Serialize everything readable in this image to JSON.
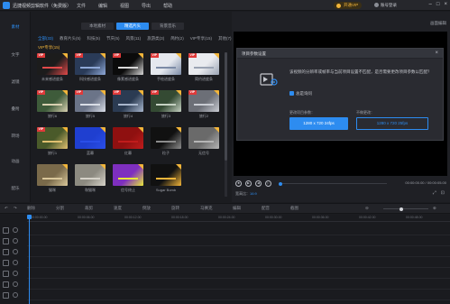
{
  "app": {
    "title": "迅捷视频剪辑软件（免费版）",
    "menu": [
      "文件",
      "编辑",
      "视图",
      "导出",
      "帮助"
    ],
    "vip_label": "开通VIP",
    "user_label": "账号登录",
    "window_buttons": [
      "–",
      "□",
      "×"
    ]
  },
  "left_nav": [
    "素材",
    "文字",
    "滤镜",
    "叠附",
    "转场",
    "动画",
    "配乐"
  ],
  "library": {
    "top_tabs": [
      "本地素材",
      "精选片头",
      "背景音乐"
    ],
    "active_top_tab": 1,
    "sub_tabs": [
      "全部(33)",
      "教育片头(5)",
      "科技(5)",
      "节庆(5)",
      "风景(11)",
      "旅游类(3)",
      "简约(2)",
      "VIP专享(15)",
      "其他(7)"
    ],
    "section_title": "VIP专享(15)",
    "items": [
      {
        "label": "未来感进度条",
        "vip": true,
        "color": "#1c1c1c",
        "accent": "#e24a4a"
      },
      {
        "label": "科技感进度条",
        "vip": true,
        "color": "#2a3b58",
        "accent": "#8fa9d8"
      },
      {
        "label": "像素感进度条",
        "vip": true,
        "color": "#0b0b0b",
        "accent": "#d8d8d8"
      },
      {
        "label": "手绘进度条",
        "vip": true,
        "color": "#e5e8ee",
        "accent": "#7c8ba6"
      },
      {
        "label": "简约进度条",
        "vip": true,
        "color": "#e9ebef",
        "accent": "#9aa3b3"
      },
      {
        "label": "旅行6",
        "vip": true,
        "color": "#3e5b3a",
        "accent": "#d8d0b0"
      },
      {
        "label": "旅行5",
        "vip": true,
        "color": "#6b7488",
        "accent": "#d9dde6"
      },
      {
        "label": "旅行4",
        "vip": true,
        "color": "#2b3b52",
        "accent": "#a8b6cc"
      },
      {
        "label": "旅行3",
        "vip": true,
        "color": "#344a33",
        "accent": "#c5d1c2"
      },
      {
        "label": "旅行2",
        "vip": true,
        "color": "#6c6f77",
        "accent": "#c9ccd3"
      },
      {
        "label": "旅行1",
        "vip": true,
        "color": "#4a5a2a",
        "accent": "#e0c070"
      },
      {
        "label": "蓝幕",
        "vip": false,
        "color": "#1f3fd0",
        "accent": "#2a4ee8"
      },
      {
        "label": "红幕",
        "vip": false,
        "color": "#8f1010",
        "accent": "#c01c1c"
      },
      {
        "label": "粒子",
        "vip": false,
        "color": "#111111",
        "accent": "#8c8c8c"
      },
      {
        "label": "无信号",
        "vip": false,
        "color": "#6a6a6a",
        "accent": "#b5b5b5"
      },
      {
        "label": "猫咪",
        "vip": false,
        "color": "#7a6a4a",
        "accent": "#d9c79a"
      },
      {
        "label": "和猫咪",
        "vip": false,
        "color": "#8c8a80",
        "accent": "#d5d2c8"
      },
      {
        "label": "信号终止",
        "vip": false,
        "color": "#7e2fbf",
        "accent": "#e8e83a"
      },
      {
        "label": "Sugar Bomb",
        "vip": false,
        "color": "#111111",
        "accent": "#f2b53a"
      }
    ]
  },
  "preview": {
    "label": "画面编辑",
    "time": "00:00:00.00 / 00:00:05.00",
    "ratio_label": "宽高比：",
    "ratio_value": "16:9",
    "fit_icons": [
      "⤢",
      "⊡"
    ]
  },
  "dialog": {
    "title": "项目参数设置",
    "close": "×",
    "message": "该视频的分辨率或帧率与当前项目设置不匹配，是否需要更改项目参数以匹配？",
    "checkbox_label": "总是询问",
    "change_label": "更改项目参数：",
    "keep_label": "不做更改：",
    "change_button": "1280 x 720 24fps",
    "keep_button": "1280 x 720 25fps"
  },
  "toolbar": {
    "tools": [
      "撤销",
      "重做",
      "删除",
      "分割",
      "裁剪",
      "速度",
      "倒放",
      "旋转",
      "马赛克",
      "编辑",
      "配音",
      "截图"
    ],
    "zoom_level": 0.4
  },
  "timeline": {
    "ruler_ticks": [
      "00:00:00.00",
      "00:00:06.00",
      "00:00:12.00",
      "00:00:18.00",
      "00:00:24.00",
      "00:00:30.00",
      "00:00:36.00",
      "00:00:42.00",
      "00:00:48.00",
      "00:00:54.00"
    ],
    "track_count": 7
  }
}
